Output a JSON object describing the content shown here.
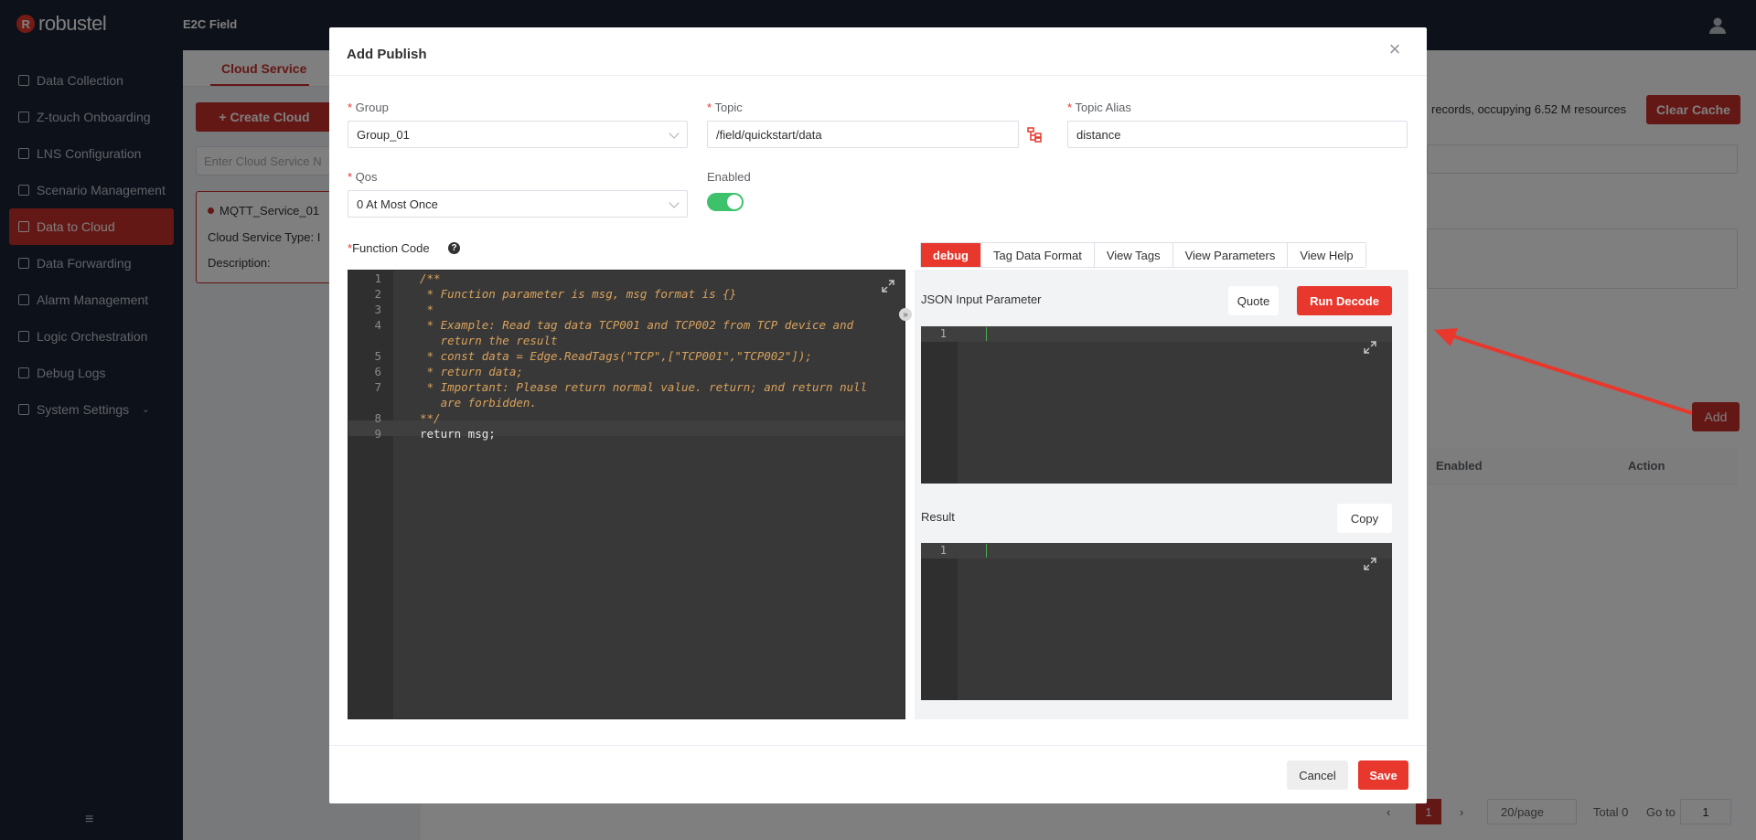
{
  "app": {
    "brand": "robustel",
    "name": "E2C Field"
  },
  "sidebar": {
    "items": [
      {
        "label": "Data Collection",
        "icon": "data-collection-icon"
      },
      {
        "label": "Z-touch Onboarding",
        "icon": "z-touch-icon"
      },
      {
        "label": "LNS Configuration",
        "icon": "lns-icon"
      },
      {
        "label": "Scenario Management",
        "icon": "scenario-icon"
      },
      {
        "label": "Data to Cloud",
        "icon": "cloud-icon",
        "active": true
      },
      {
        "label": "Data Forwarding",
        "icon": "forwarding-icon"
      },
      {
        "label": "Alarm Management",
        "icon": "alarm-icon"
      },
      {
        "label": "Logic Orchestration",
        "icon": "logic-icon"
      },
      {
        "label": "Debug Logs",
        "icon": "logs-icon"
      },
      {
        "label": "System Settings",
        "icon": "settings-icon"
      }
    ],
    "collapse": "≡"
  },
  "background": {
    "tab": "Cloud Service",
    "create_button": "+ Create Cloud",
    "search_placeholder": "Enter Cloud Service N",
    "card": {
      "name": "MQTT_Service_01",
      "type_label": "Cloud Service Type:",
      "type_value": "I",
      "desc_label": "Description:"
    },
    "records_text": "records, occupying 6.52 M resources",
    "clear_cache": "Clear Cache",
    "add_button": "Add",
    "table_headers": [
      "Enabled",
      "Action"
    ],
    "pagination": {
      "current": "1",
      "page_size": "20/page",
      "total": "Total 0",
      "goto_label": "Go to",
      "goto_value": "1"
    }
  },
  "dialog": {
    "title": "Add Publish",
    "close": "×",
    "fields": {
      "group": {
        "label": "Group",
        "value": "Group_01"
      },
      "topic": {
        "label": "Topic",
        "value": "/field/quickstart/data"
      },
      "topic_alias": {
        "label": "Topic Alias",
        "value": "distance"
      },
      "qos": {
        "label": "Qos",
        "value": "0 At Most Once"
      },
      "enabled": {
        "label": "Enabled",
        "value": true
      }
    },
    "function_code_label": "Function Code",
    "code_lines": [
      {
        "n": "1",
        "text": "/**"
      },
      {
        "n": "2",
        "text": " * Function parameter is msg, msg format is {}"
      },
      {
        "n": "3",
        "text": " *"
      },
      {
        "n": "4",
        "text": " * Example: Read tag data TCP001 and TCP002 from TCP device and"
      },
      {
        "n": "",
        "text": "   return the result"
      },
      {
        "n": "5",
        "text": " * const data = Edge.ReadTags(\"TCP\",[\"TCP001\",\"TCP002\"]);"
      },
      {
        "n": "6",
        "text": " * return data;"
      },
      {
        "n": "7",
        "text": " * Important: Please return normal value. return; and return null"
      },
      {
        "n": "",
        "text": "   are forbidden."
      },
      {
        "n": "8",
        "text": "**/"
      },
      {
        "n": "9",
        "text": "return msg;"
      }
    ],
    "tabs": [
      "debug",
      "Tag Data Format",
      "View Tags",
      "View Parameters",
      "View Help"
    ],
    "json_input_label": "JSON Input Parameter",
    "quote_button": "Quote",
    "run_decode_button": "Run Decode",
    "result_label": "Result",
    "copy_button": "Copy",
    "mini_line": "1",
    "cancel_button": "Cancel",
    "save_button": "Save"
  },
  "colors": {
    "accent": "#e8372c",
    "sidebar": "#1a2234",
    "toggle_on": "#3ec16b",
    "editor_bg": "#383838"
  }
}
